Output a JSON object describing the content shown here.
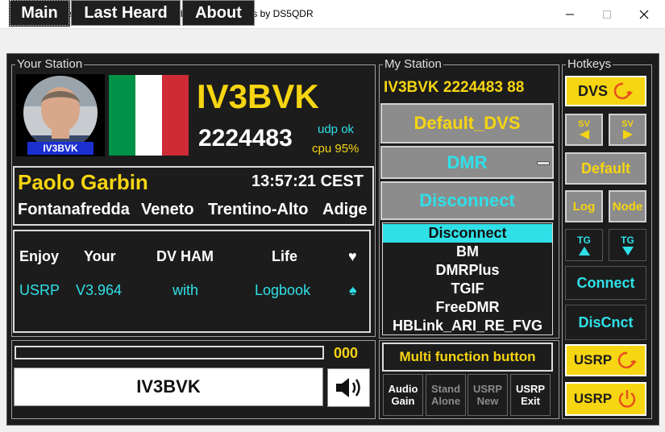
{
  "window": {
    "title": "USRP Client Version 3.964 with Logbook for Windows by DS5QDR"
  },
  "tabs": [
    "Main",
    "Last Heard",
    "About"
  ],
  "your_station": {
    "legend": "Your Station",
    "avatar_label": "IV3BVK",
    "callsign": "IV3BVK",
    "dmr_id": "2224483",
    "udp_status": "udp ok",
    "cpu": "cpu 95%",
    "name": "Paolo Garbin",
    "time": "13:57:21 CEST",
    "location": [
      "Fontanafredda",
      "Veneto",
      "Trentino-Alto",
      "Adige"
    ],
    "info_rows": [
      [
        "Enjoy",
        "Your",
        "DV HAM",
        "Life",
        "♥"
      ],
      [
        "USRP",
        "V3.964",
        "with",
        "Logbook",
        "♠"
      ]
    ]
  },
  "transmit": {
    "counter": "000",
    "callsign_display": "IV3BVK",
    "level": 0
  },
  "my_station": {
    "legend": "My Station",
    "header": "IV3BVK 2224483 88",
    "profile_button": "Default_DVS",
    "mode_select": "DMR",
    "connect_button": "Disconnect",
    "server_list": [
      "Disconnect",
      "BM",
      "DMRPlus",
      "TGIF",
      "FreeDMR",
      "HBLink_ARI_RE_FVG"
    ],
    "selected_server": 0,
    "multi_function": "Multi function button",
    "small_buttons": [
      {
        "line1": "Audio",
        "line2": "Gain",
        "enabled": true
      },
      {
        "line1": "Stand",
        "line2": "Alone",
        "enabled": false
      },
      {
        "line1": "USRP",
        "line2": "New",
        "enabled": false
      },
      {
        "line1": "USRP",
        "line2": "Exit",
        "enabled": true
      }
    ]
  },
  "hotkeys": {
    "legend": "Hotkeys",
    "dvs": "DVS",
    "sv": "SV",
    "default": "Default",
    "log": "Log",
    "node": "Node",
    "tg": "TG",
    "connect": "Connect",
    "disconnect": "DisCnct",
    "usrp_restart": "USRP",
    "usrp_power": "USRP"
  },
  "colors": {
    "accent_yellow": "#f6d512",
    "accent_cyan": "#2fe0e8",
    "panel_bg": "#1c1c1c",
    "button_gray": "#8c8c8c"
  }
}
